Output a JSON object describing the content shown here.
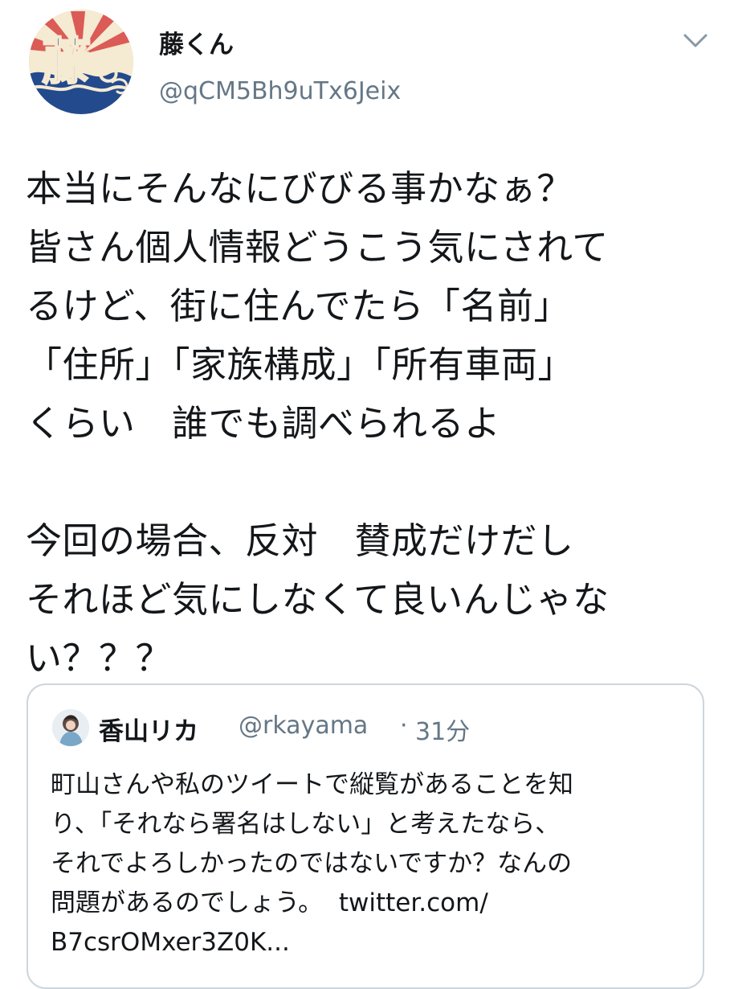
{
  "author": {
    "display_name": "藤くん",
    "handle": "@qCM5Bh9uTx6Jeix",
    "avatar_icon": "fuji-kanji-wave-avatar-icon"
  },
  "menu": {
    "caret_icon": "chevron-down-icon"
  },
  "tweet": {
    "lines": [
      "本当にそんなにびびる事かなぁ？",
      "皆さん個人情報どうこう気にされて",
      "るけど、街に住んでたら「名前」",
      "「住所」「家族構成」「所有車両」",
      "くらい　誰でも調べられるよ",
      "",
      "今回の場合、反対　賛成だけだし",
      "それほど気にしなくて良いんじゃな",
      "い？？？"
    ]
  },
  "quote": {
    "display_name": "香山リカ",
    "handle": "@rkayama",
    "separator": "·",
    "time": "31分",
    "avatar_icon": "profile-photo-icon",
    "lines": [
      "町山さんや私のツイートで縦覧があることを知",
      "り、「それなら署名はしない」と考えたなら、",
      "それでよろしかったのではないですか？なんの",
      "問題があるのでしょう。",
      "B7csrOMxer3Z0K..."
    ],
    "link_part": "twitter.com/"
  },
  "colors": {
    "text": "#14171a",
    "secondary": "#657786",
    "border": "#ccd6dd",
    "avatar_blue": "#1f3f78",
    "avatar_red": "#c8403b"
  }
}
